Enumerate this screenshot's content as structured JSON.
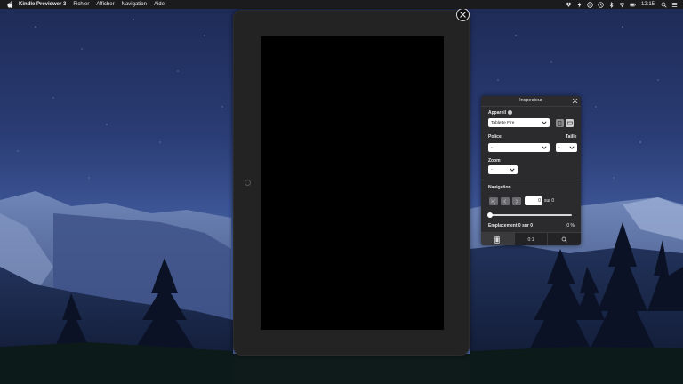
{
  "menubar": {
    "app_name": "Kindle Previewer 3",
    "menus": [
      "Fichier",
      "Afficher",
      "Navigation",
      "Aide"
    ],
    "clock": "12:15"
  },
  "inspector": {
    "title": "Inspecteur",
    "appareil_label": "Appareil",
    "appareil_value": "Tablette Fire",
    "police_label": "Police",
    "police_value": "-",
    "taille_label": "Taille",
    "taille_value": "-",
    "zoom_label": "Zoom",
    "zoom_value": "-",
    "navigation_label": "Navigation",
    "page_value": "0",
    "page_total": "sur 0",
    "location_text": "Emplacement 0 sur 0",
    "percent_text": "0 %",
    "progress": 0,
    "tabs": {
      "toc": "0:1"
    }
  }
}
